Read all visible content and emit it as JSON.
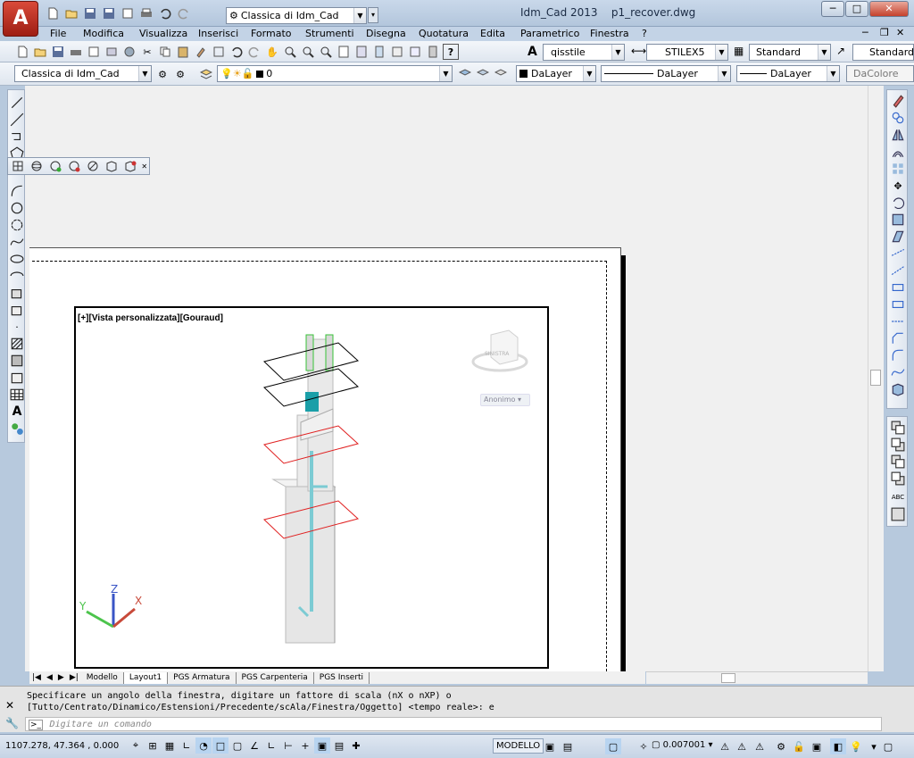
{
  "app": {
    "title": "Idm_Cad 2013",
    "file": "p1_recover.dwg",
    "workspace": "Classica di Idm_Cad"
  },
  "menu": [
    "File",
    "Modifica",
    "Visualizza",
    "Inserisci",
    "Formato",
    "Strumenti",
    "Disegna",
    "Quotatura",
    "Edita",
    "Parametrico",
    "Finestra",
    "?"
  ],
  "styles": {
    "text_style": "qisstile",
    "dim_style": "STILEX5",
    "table_style": "Standard",
    "multileader_style": "Standard"
  },
  "layers": {
    "workspace": "Classica di Idm_Cad",
    "current_layer": "0",
    "color": "DaLayer",
    "linetype": "DaLayer",
    "lineweight": "DaLayer",
    "plotstyle": "DaColore"
  },
  "viewport": {
    "label": "[+][Vista personalizzata][Gouraud]",
    "viewcube_label": "Anonimo",
    "viewcube_face": "SINISTRA"
  },
  "ucs": {
    "x": "X",
    "y": "Y",
    "z": "Z"
  },
  "layout_tabs": [
    "Modello",
    "Layout1",
    "PGS Armatura",
    "PGS Carpenteria",
    "PGS Inserti"
  ],
  "active_tab": "Layout1",
  "command": {
    "line1": "Specificare un angolo della finestra, digitare un fattore di scala (nX o nXP) o",
    "line2": "[Tutto/Centrato/Dinamico/Estensioni/Precedente/scAla/Finestra/Oggetto] <tempo reale>: e",
    "placeholder": "Digitare un comando"
  },
  "status": {
    "coords": "1107.278, 47.364 , 0.000",
    "space": "MODELLO",
    "scale": "0.007001"
  },
  "colors": {
    "accent": "#c6352a",
    "wire_red": "#e02020",
    "teal": "#1a9fa8",
    "green_edge": "#38c238"
  }
}
